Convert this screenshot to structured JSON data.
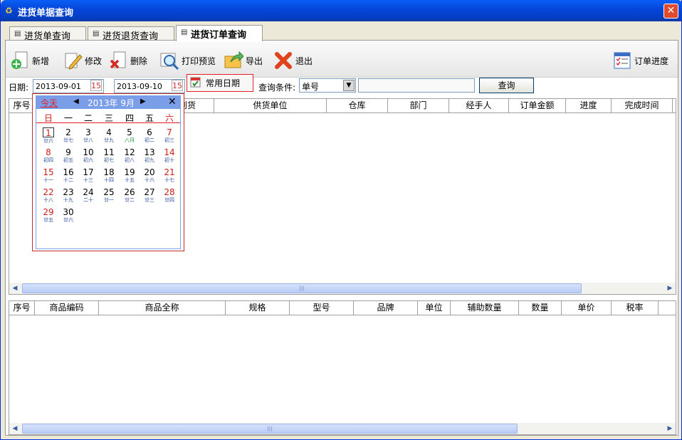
{
  "window": {
    "title": "进货单据查询",
    "close": "✕"
  },
  "tabs": [
    {
      "label": "进货单查询"
    },
    {
      "label": "进货退货查询"
    },
    {
      "label": "进货订单查询"
    }
  ],
  "toolbar": {
    "add": "新增",
    "edit": "修改",
    "delete": "删除",
    "print_preview": "打印预览",
    "export": "导出",
    "exit": "退出",
    "order_progress": "订单进度"
  },
  "filter": {
    "date_label": "日期:",
    "date_from": "2013-09-01",
    "date_to": "2013-09-10",
    "common_date": "常用日期",
    "cond_label": "查询条件:",
    "cond_value": "单号",
    "cond_input": "",
    "query": "查询"
  },
  "grid1": {
    "columns": [
      "序号",
      "到货",
      "供货单位",
      "仓库",
      "部门",
      "经手人",
      "订单金额",
      "进度",
      "完成时间"
    ]
  },
  "grid2": {
    "columns": [
      "序号",
      "商品编码",
      "商品全称",
      "规格",
      "型号",
      "品牌",
      "单位",
      "辅助数量",
      "数量",
      "单价",
      "税率"
    ]
  },
  "calendar": {
    "today": "今天",
    "month": "2013年 9月",
    "weekdays": [
      "日",
      "一",
      "二",
      "三",
      "四",
      "五",
      "六"
    ],
    "days": [
      {
        "d": "1",
        "l": "廿六"
      },
      {
        "d": "2",
        "l": "廿七"
      },
      {
        "d": "3",
        "l": "廿八"
      },
      {
        "d": "4",
        "l": "廿九"
      },
      {
        "d": "5",
        "l": "八月"
      },
      {
        "d": "6",
        "l": "初二"
      },
      {
        "d": "7",
        "l": "初三"
      },
      {
        "d": "8",
        "l": "初四"
      },
      {
        "d": "9",
        "l": "初五"
      },
      {
        "d": "10",
        "l": "初六"
      },
      {
        "d": "11",
        "l": "初七"
      },
      {
        "d": "12",
        "l": "初八"
      },
      {
        "d": "13",
        "l": "初九"
      },
      {
        "d": "14",
        "l": "初十"
      },
      {
        "d": "15",
        "l": "十一"
      },
      {
        "d": "16",
        "l": "十二"
      },
      {
        "d": "17",
        "l": "十三"
      },
      {
        "d": "18",
        "l": "十四"
      },
      {
        "d": "19",
        "l": "十五"
      },
      {
        "d": "20",
        "l": "十六"
      },
      {
        "d": "21",
        "l": "十七"
      },
      {
        "d": "22",
        "l": "十八"
      },
      {
        "d": "23",
        "l": "十九"
      },
      {
        "d": "24",
        "l": "二十"
      },
      {
        "d": "25",
        "l": "廿一"
      },
      {
        "d": "26",
        "l": "廿二"
      },
      {
        "d": "27",
        "l": "廿三"
      },
      {
        "d": "28",
        "l": "廿四"
      },
      {
        "d": "29",
        "l": "廿五"
      },
      {
        "d": "30",
        "l": "廿六"
      }
    ]
  },
  "scroll": {
    "thumb_grip": "|||"
  },
  "colors": {
    "titlebar": "#0445d8",
    "highlight_border": "#e31e25",
    "calendar_header": "#7b9ee8"
  }
}
